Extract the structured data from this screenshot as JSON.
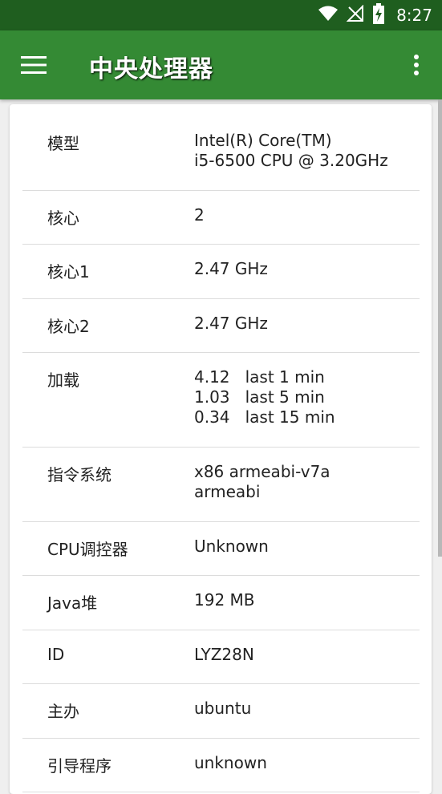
{
  "status_bar": {
    "time": "8:27",
    "icons": [
      "wifi-icon",
      "no-signal-icon",
      "battery-charging-icon"
    ]
  },
  "app_bar": {
    "title": "中央处理器",
    "menu_icon": "hamburger-menu-icon",
    "more_icon": "more-vert-icon"
  },
  "rows": [
    {
      "label": "模型",
      "lines": [
        "Intel(R) Core(TM)",
        "i5-6500 CPU @ 3.20GHz"
      ]
    },
    {
      "label": "核心",
      "lines": [
        "2"
      ]
    },
    {
      "label": "核心1",
      "lines": [
        "2.47 GHz"
      ]
    },
    {
      "label": "核心2",
      "lines": [
        "2.47 GHz"
      ]
    },
    {
      "label": "加载",
      "lines": [
        "4.12   last 1 min",
        "1.03   last 5 min",
        "0.34   last 15 min"
      ]
    },
    {
      "label": "指令系统",
      "lines": [
        "x86 armeabi-v7a",
        "armeabi"
      ]
    },
    {
      "label": "CPU调控器",
      "lines": [
        "Unknown"
      ]
    },
    {
      "label": "Java堆",
      "lines": [
        "192 MB"
      ]
    },
    {
      "label": "ID",
      "lines": [
        "LYZ28N"
      ]
    },
    {
      "label": "主办",
      "lines": [
        "ubuntu"
      ]
    },
    {
      "label": "引导程序",
      "lines": [
        "unknown"
      ]
    }
  ]
}
